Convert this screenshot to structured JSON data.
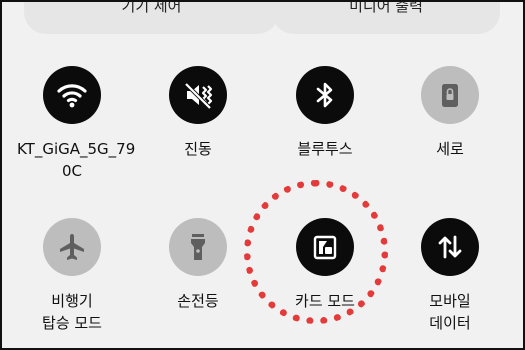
{
  "top_controls": {
    "left_label": "기기 제어",
    "right_label": "미디어 출력"
  },
  "tiles": [
    {
      "label_line1": "KT_GiGA_5G_79",
      "label_line2": "0C",
      "state": "on",
      "icon": "wifi-icon"
    },
    {
      "label_line1": "진동",
      "label_line2": "",
      "state": "on",
      "icon": "vibrate-icon"
    },
    {
      "label_line1": "블루투스",
      "label_line2": "",
      "state": "on",
      "icon": "bluetooth-icon"
    },
    {
      "label_line1": "세로",
      "label_line2": "",
      "state": "off",
      "icon": "lock-rotation-icon"
    },
    {
      "label_line1": "비행기",
      "label_line2": "탑승 모드",
      "state": "off",
      "icon": "airplane-icon"
    },
    {
      "label_line1": "손전등",
      "label_line2": "",
      "state": "off",
      "icon": "flashlight-icon"
    },
    {
      "label_line1": "카드 모드",
      "label_line2": "",
      "state": "on",
      "icon": "card-mode-icon"
    },
    {
      "label_line1": "모바일",
      "label_line2": "데이터",
      "state": "on",
      "icon": "mobile-data-icon"
    }
  ],
  "colors": {
    "active": "#0b0b0b",
    "inactive": "#bdbdbd",
    "highlight": "#e43a3a"
  }
}
